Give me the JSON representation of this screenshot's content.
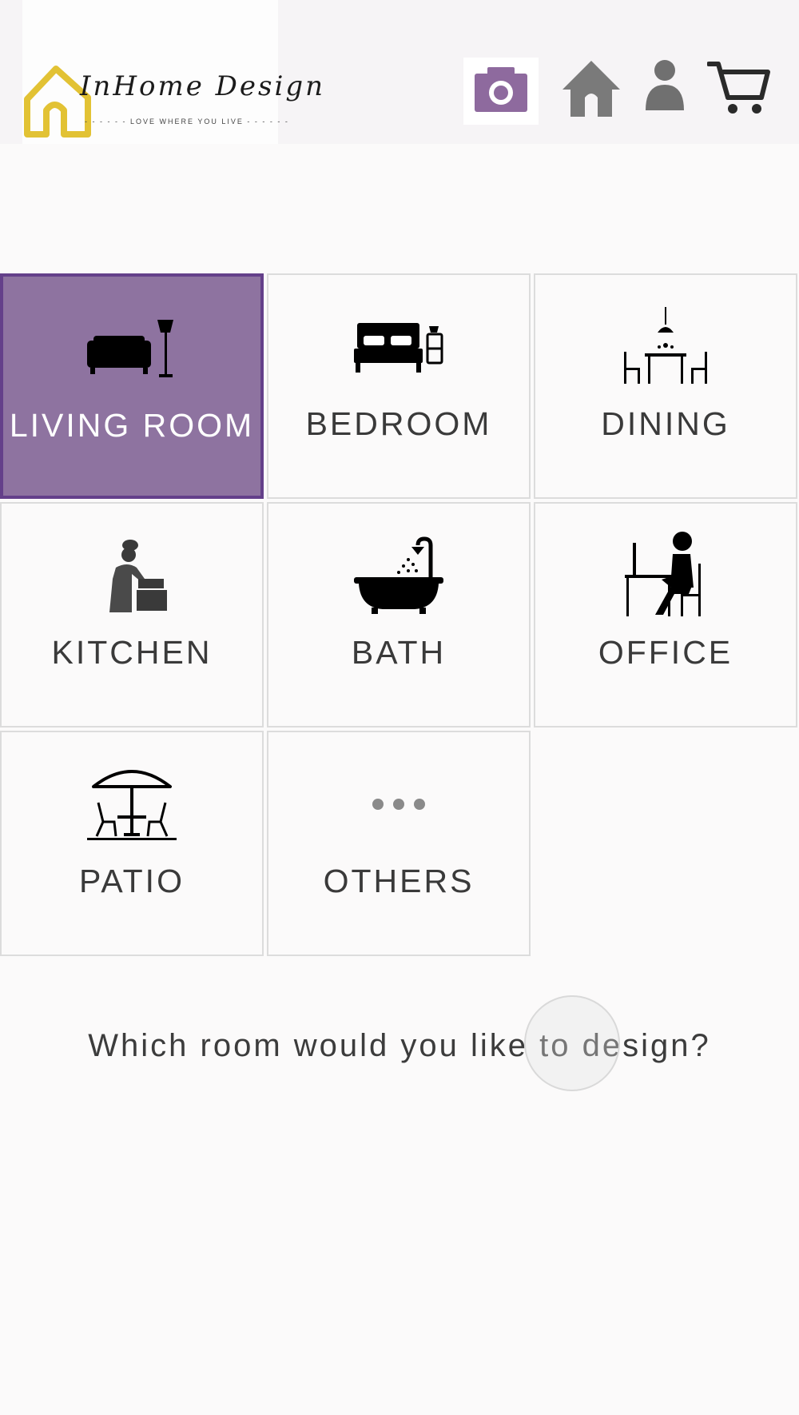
{
  "header": {
    "logo_title": "InHome Design",
    "logo_tagline": "- - - - - - LOVE WHERE YOU LIVE - - - - - -",
    "icons": [
      "camera-icon",
      "home-icon",
      "user-icon",
      "cart-icon"
    ],
    "accent_color": "#8e6a9e",
    "logo_color": "#e2c234"
  },
  "rooms": [
    {
      "label": "LIVING ROOM",
      "icon": "sofa-lamp-icon",
      "selected": true
    },
    {
      "label": "BEDROOM",
      "icon": "bed-icon",
      "selected": false
    },
    {
      "label": "DINING",
      "icon": "dining-table-icon",
      "selected": false
    },
    {
      "label": "KITCHEN",
      "icon": "chef-icon",
      "selected": false
    },
    {
      "label": "BATH",
      "icon": "bathtub-icon",
      "selected": false
    },
    {
      "label": "OFFICE",
      "icon": "desk-worker-icon",
      "selected": false
    },
    {
      "label": "PATIO",
      "icon": "umbrella-table-icon",
      "selected": false
    },
    {
      "label": "OTHERS",
      "icon": "ellipsis-icon",
      "selected": false
    }
  ],
  "prompt": "Which room would you like to design?"
}
